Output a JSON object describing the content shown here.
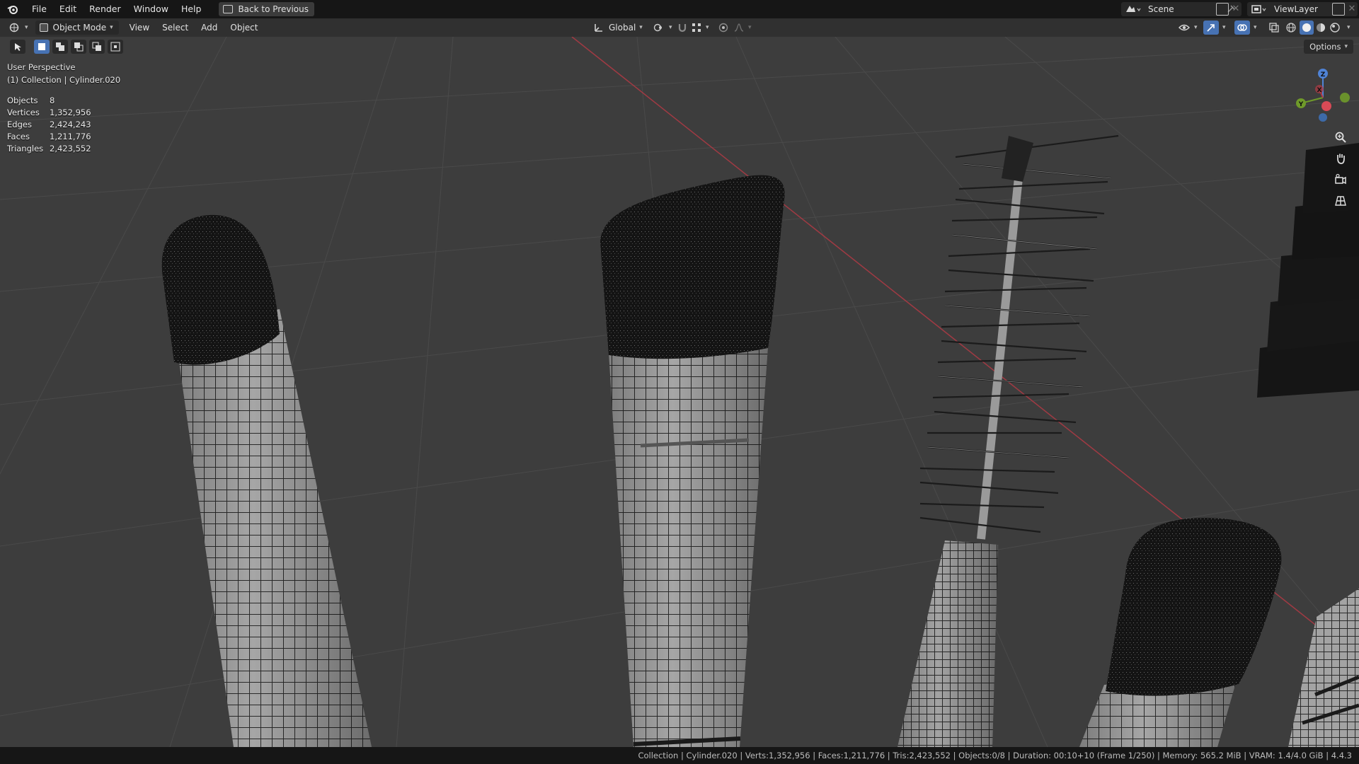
{
  "topbar": {
    "menus": [
      "File",
      "Edit",
      "Render",
      "Window",
      "Help"
    ],
    "back_button": "Back to Previous",
    "scene": "Scene",
    "view_layer": "ViewLayer"
  },
  "header": {
    "mode": "Object Mode",
    "menus": [
      "View",
      "Select",
      "Add",
      "Object"
    ],
    "transform_orientation": "Global"
  },
  "viewport": {
    "perspective": "User Perspective",
    "active_object": "(1) Collection | Cylinder.020",
    "options": "Options",
    "stats": [
      {
        "label": "Objects",
        "value": "8"
      },
      {
        "label": "Vertices",
        "value": "1,352,956"
      },
      {
        "label": "Edges",
        "value": "2,424,243"
      },
      {
        "label": "Faces",
        "value": "1,211,776"
      },
      {
        "label": "Triangles",
        "value": "2,423,552"
      }
    ],
    "gizmo": {
      "x": "X",
      "y": "Y",
      "z": "Z"
    }
  },
  "statusbar": {
    "text": "Collection | Cylinder.020 | Verts:1,352,956 | Faces:1,211,776 | Tris:2,423,552 | Objects:0/8 | Duration: 00:10+10 (Frame 1/250) | Memory: 565.2 MiB | VRAM: 1.4/4.0 GiB | 4.4.3"
  },
  "colors": {
    "viewport_bg": "#3d3d3d",
    "x_axis": "#b23a45",
    "active_tool": "#4772b3",
    "bristles": "#121212",
    "handle": "#a9a9a9"
  }
}
